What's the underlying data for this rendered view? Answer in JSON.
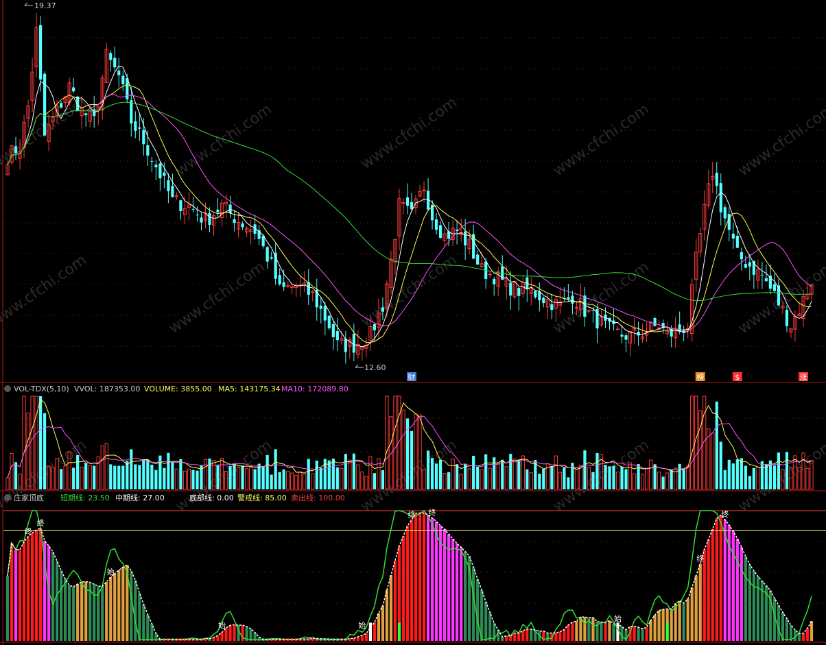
{
  "colors": {
    "up": "#ff3b3b",
    "down": "#54ffff",
    "ma_white": "#ffffff",
    "ma_yellow": "#ffff55",
    "ma_magenta": "#ff55ff",
    "ma_green": "#33dd33",
    "panel_border": "#b01818",
    "grid": "#8a1010",
    "watermark": "#2a2a2a"
  },
  "price_panel": {
    "high_label": "19.37",
    "low_label": "12.60",
    "ylim": [
      12.3,
      19.6
    ],
    "markers": [
      {
        "text": "财",
        "index": 98,
        "color": "#3a7bd5"
      },
      {
        "text": "榜",
        "index": 168,
        "color": "#e08a1a"
      },
      {
        "text": "$",
        "index": 177,
        "color": "#ff3030"
      },
      {
        "text": "涨",
        "index": 193,
        "color": "#ff3030"
      }
    ]
  },
  "volume_panel": {
    "indicator": "VOL-TDX(5,10)",
    "vvol_label": "VVOL: 187353.00",
    "volume_label": "VOLUME: 3855.00",
    "ma5_label": "MA5: 143175.34",
    "ma10_label": "MA10: 172089.80"
  },
  "zhuang_panel": {
    "indicator": "庄家顶底",
    "short_label": "短期线: 23.50",
    "mid_label": "中期线: 27.00",
    "bottom_label": "底部线: 0.00",
    "warn_label": "警戒线: 85.00",
    "sell_label": "卖出线: 100.00",
    "signals": [
      {
        "text": "终",
        "index": 5
      },
      {
        "text": "终",
        "index": 8
      },
      {
        "text": "始",
        "index": 25
      },
      {
        "text": "始",
        "index": 52
      },
      {
        "text": "始",
        "index": 86
      },
      {
        "text": "终",
        "index": 98
      },
      {
        "text": "终",
        "index": 103
      },
      {
        "text": "始",
        "index": 148
      },
      {
        "text": "终",
        "index": 168
      },
      {
        "text": "终",
        "index": 174
      }
    ]
  },
  "watermark": "www.cfchi.com",
  "chart_data": {
    "type": "candlestick",
    "count": 196,
    "anchors_close": [
      [
        0,
        16.6
      ],
      [
        3,
        16.8
      ],
      [
        5,
        17.6
      ],
      [
        7,
        19.1
      ],
      [
        9,
        17.0
      ],
      [
        12,
        17.5
      ],
      [
        15,
        18.0
      ],
      [
        18,
        17.5
      ],
      [
        21,
        17.3
      ],
      [
        24,
        18.6
      ],
      [
        27,
        18.2
      ],
      [
        30,
        17.3
      ],
      [
        33,
        16.9
      ],
      [
        36,
        16.4
      ],
      [
        40,
        15.7
      ],
      [
        44,
        15.6
      ],
      [
        48,
        15.3
      ],
      [
        52,
        15.6
      ],
      [
        56,
        15.3
      ],
      [
        60,
        15.1
      ],
      [
        64,
        14.4
      ],
      [
        66,
        13.9
      ],
      [
        70,
        14.0
      ],
      [
        74,
        13.8
      ],
      [
        78,
        13.2
      ],
      [
        80,
        12.8
      ],
      [
        84,
        12.8
      ],
      [
        88,
        13.0
      ],
      [
        91,
        13.6
      ],
      [
        93,
        14.5
      ],
      [
        95,
        15.6
      ],
      [
        98,
        15.4
      ],
      [
        101,
        16.0
      ],
      [
        103,
        15.4
      ],
      [
        106,
        15.0
      ],
      [
        109,
        15.1
      ],
      [
        112,
        14.8
      ],
      [
        115,
        14.3
      ],
      [
        118,
        14.2
      ],
      [
        121,
        14.0
      ],
      [
        124,
        13.9
      ],
      [
        127,
        13.9
      ],
      [
        131,
        13.7
      ],
      [
        134,
        13.6
      ],
      [
        137,
        13.8
      ],
      [
        140,
        13.5
      ],
      [
        143,
        13.3
      ],
      [
        146,
        13.1
      ],
      [
        149,
        13.0
      ],
      [
        152,
        13.0
      ],
      [
        155,
        13.1
      ],
      [
        158,
        13.2
      ],
      [
        160,
        13.0
      ],
      [
        163,
        13.1
      ],
      [
        165,
        13.2
      ],
      [
        167,
        14.5
      ],
      [
        169,
        15.5
      ],
      [
        171,
        16.3
      ],
      [
        173,
        15.6
      ],
      [
        175,
        15.1
      ],
      [
        177,
        14.6
      ],
      [
        180,
        14.4
      ],
      [
        183,
        14.2
      ],
      [
        186,
        13.8
      ],
      [
        188,
        13.5
      ],
      [
        190,
        13.2
      ],
      [
        193,
        13.7
      ],
      [
        195,
        14.1
      ]
    ],
    "volume_scale": "relative",
    "zhuang_ranges": {
      "short": "0-100",
      "warn": 85,
      "sell": 100,
      "bottom": 0
    }
  }
}
